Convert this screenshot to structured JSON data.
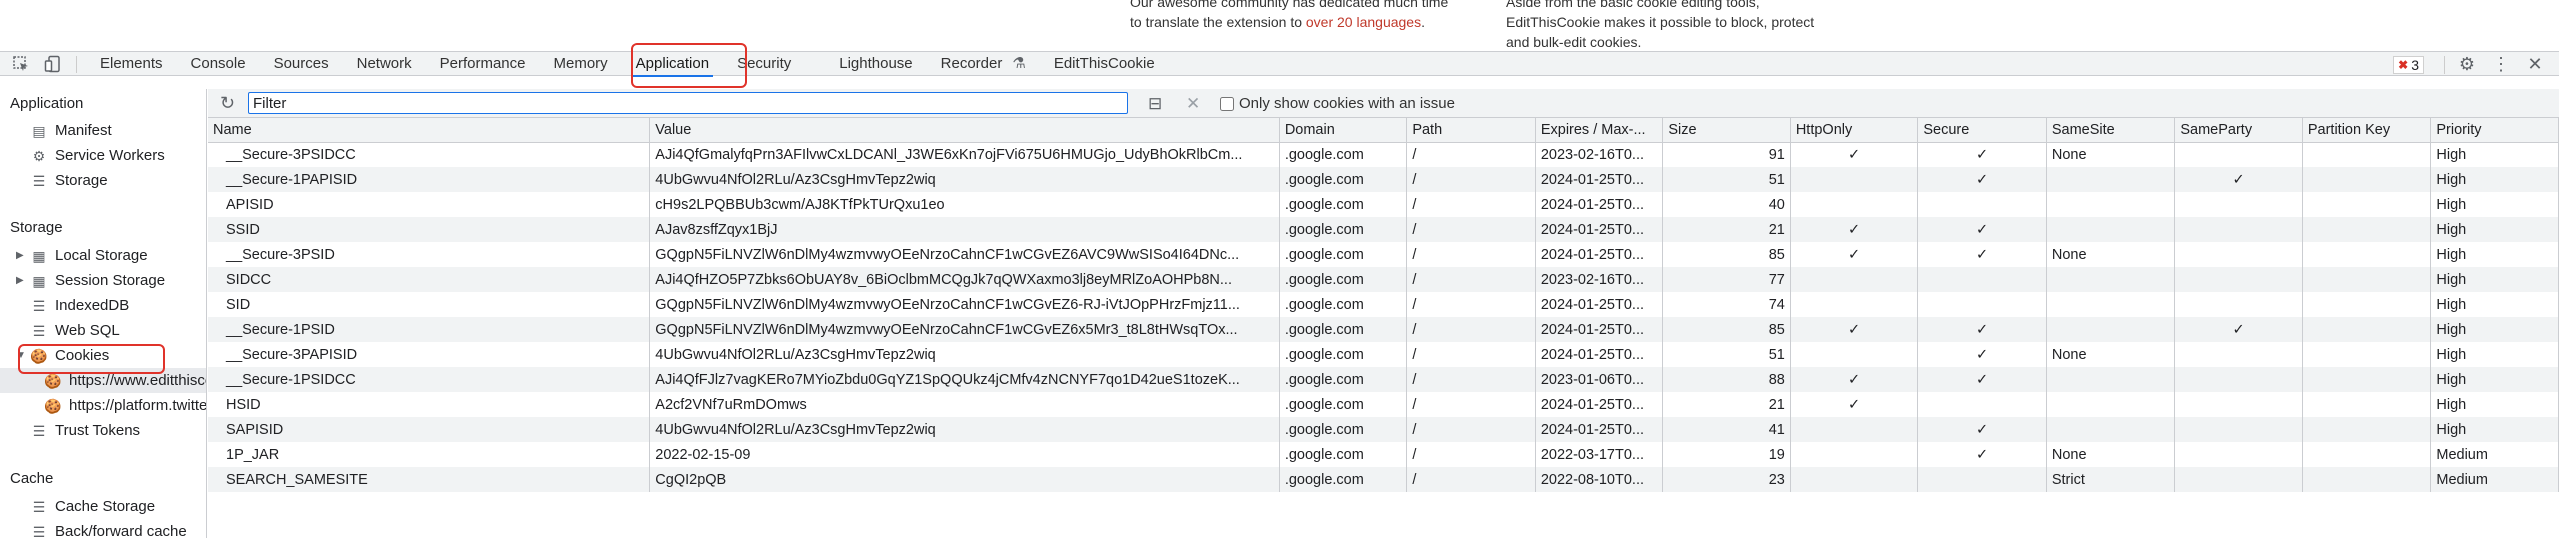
{
  "page_strip": {
    "col1_line1": "Our awesome community has dedicated much time",
    "col1_line2_prefix": "to translate the extension to ",
    "col1_line2_link": "over 20 languages",
    "col1_line2_suffix": ".",
    "col2_line1": "Aside from the basic cookie editing tools,",
    "col2_line2": "EditThisCookie makes it possible to block, protect",
    "col2_line3": "and bulk-edit cookies."
  },
  "toolbar": {
    "tabs": [
      "Elements",
      "Console",
      "Sources",
      "Network",
      "Performance",
      "Memory",
      "Application",
      "Security",
      "Lighthouse",
      "Recorder",
      "EditThisCookie"
    ],
    "active_tab": "Application",
    "error_count": "3"
  },
  "sidebar": {
    "application_header": "Application",
    "application_items": [
      "Manifest",
      "Service Workers",
      "Storage"
    ],
    "storage_header": "Storage",
    "storage_items": [
      "Local Storage",
      "Session Storage",
      "IndexedDB",
      "Web SQL",
      "Cookies"
    ],
    "cookie_hosts": [
      "https://www.editthiscookie.com",
      "https://platform.twitter.com"
    ],
    "trust_tokens": "Trust Tokens",
    "cache_header": "Cache",
    "cache_items": [
      "Cache Storage",
      "Back/forward cache"
    ]
  },
  "filter": {
    "placeholder": "Filter",
    "only_issue_label": "Only show cookies with an issue"
  },
  "table": {
    "columns": [
      "Name",
      "Value",
      "Domain",
      "Path",
      "Expires / Max-...",
      "Size",
      "HttpOnly",
      "Secure",
      "SameSite",
      "SameParty",
      "Partition Key",
      "Priority"
    ],
    "rows": [
      [
        "__Secure-3PSIDCC",
        "AJi4QfGmalyfqPrn3AFIlvwCxLDCANl_J3WE6xKn7ojFVi675U6HMUGjo_UdyBhOkRlbCm...",
        ".google.com",
        "/",
        "2023-02-16T0...",
        "91",
        "✓",
        "✓",
        "None",
        "",
        "",
        "High"
      ],
      [
        "__Secure-1PAPISID",
        "4UbGwvu4NfOl2RLu/Az3CsgHmvTepz2wiq",
        ".google.com",
        "/",
        "2024-01-25T0...",
        "51",
        "",
        "✓",
        "",
        "✓",
        "",
        "High"
      ],
      [
        "APISID",
        "cH9s2LPQBBUb3cwm/AJ8KTfPkTUrQxu1eo",
        ".google.com",
        "/",
        "2024-01-25T0...",
        "40",
        "",
        "",
        "",
        "",
        "",
        "High"
      ],
      [
        "SSID",
        "AJav8zsffZqyx1BjJ",
        ".google.com",
        "/",
        "2024-01-25T0...",
        "21",
        "✓",
        "✓",
        "",
        "",
        "",
        "High"
      ],
      [
        "__Secure-3PSID",
        "GQgpN5FiLNVZlW6nDlMy4wzmvwyOEeNrzoCahnCF1wCGvEZ6AVC9WwSISo4I64DNc...",
        ".google.com",
        "/",
        "2024-01-25T0...",
        "85",
        "✓",
        "✓",
        "None",
        "",
        "",
        "High"
      ],
      [
        "SIDCC",
        "AJi4QfHZO5P7Zbks6ObUAY8v_6BiOclbmMCQgJk7qQWXaxmo3lj8eyMRlZoAOHPb8N...",
        ".google.com",
        "/",
        "2023-02-16T0...",
        "77",
        "",
        "",
        "",
        "",
        "",
        "High"
      ],
      [
        "SID",
        "GQgpN5FiLNVZlW6nDlMy4wzmvwyOEeNrzoCahnCF1wCGvEZ6-RJ-iVtJOpPHrzFmjz11...",
        ".google.com",
        "/",
        "2024-01-25T0...",
        "74",
        "",
        "",
        "",
        "",
        "",
        "High"
      ],
      [
        "__Secure-1PSID",
        "GQgpN5FiLNVZlW6nDlMy4wzmvwyOEeNrzoCahnCF1wCGvEZ6x5Mr3_t8L8tHWsqTOx...",
        ".google.com",
        "/",
        "2024-01-25T0...",
        "85",
        "✓",
        "✓",
        "",
        "✓",
        "",
        "High"
      ],
      [
        "__Secure-3PAPISID",
        "4UbGwvu4NfOl2RLu/Az3CsgHmvTepz2wiq",
        ".google.com",
        "/",
        "2024-01-25T0...",
        "51",
        "",
        "✓",
        "None",
        "",
        "",
        "High"
      ],
      [
        "__Secure-1PSIDCC",
        "AJi4QfFJlz7vagKERo7MYioZbdu0GqYZ1SpQQUkz4jCMfv4zNCNYF7qo1D42ueS1tozeK...",
        ".google.com",
        "/",
        "2023-01-06T0...",
        "88",
        "✓",
        "✓",
        "",
        "",
        "",
        "High"
      ],
      [
        "HSID",
        "A2cf2VNf7uRmDOmws",
        ".google.com",
        "/",
        "2024-01-25T0...",
        "21",
        "✓",
        "",
        "",
        "",
        "",
        "High"
      ],
      [
        "SAPISID",
        "4UbGwvu4NfOl2RLu/Az3CsgHmvTepz2wiq",
        ".google.com",
        "/",
        "2024-01-25T0...",
        "41",
        "",
        "✓",
        "",
        "",
        "",
        "High"
      ],
      [
        "1P_JAR",
        "2022-02-15-09",
        ".google.com",
        "/",
        "2022-03-17T0...",
        "19",
        "",
        "✓",
        "None",
        "",
        "",
        "Medium"
      ],
      [
        "SEARCH_SAMESITE",
        "CgQI2pQB",
        ".google.com",
        "/",
        "2022-08-10T0...",
        "23",
        "",
        "",
        "Strict",
        "",
        "",
        "Medium"
      ]
    ]
  }
}
